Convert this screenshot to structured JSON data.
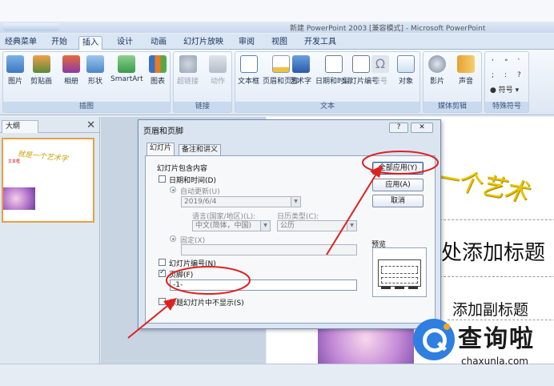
{
  "window": {
    "title": "新建 PowerPoint 2003 [兼容模式] - Microsoft PowerPoint"
  },
  "tabs": [
    "经典菜单",
    "开始",
    "插入",
    "设计",
    "动画",
    "幻灯片放映",
    "审阅",
    "视图",
    "开发工具"
  ],
  "active_tab": "插入",
  "ribbon": {
    "groups": {
      "illustrations": {
        "label": "插图",
        "buttons": [
          "图片",
          "剪贴画",
          "相册",
          "形状",
          "SmartArt",
          "图表"
        ]
      },
      "links": {
        "label": "链接",
        "buttons": [
          "超链接",
          "动作"
        ]
      },
      "text": {
        "label": "文本",
        "buttons": [
          "文本框",
          "页眉和页脚",
          "艺术字",
          "日期和时间",
          "幻灯片编号",
          "符号",
          "对象"
        ]
      },
      "media": {
        "label": "媒体剪辑",
        "buttons": [
          "影片",
          "声音"
        ]
      },
      "special": {
        "label": "特殊符号",
        "symbols": [
          "'",
          "°",
          "`",
          ";",
          ":",
          "?"
        ],
        "button": "符号"
      }
    }
  },
  "outline_pane": {
    "tab_label": "大纲",
    "close_glyph": "✕",
    "thumb_title": "就是一个艺术字",
    "thumb_subtitle": "文本框"
  },
  "slide": {
    "wordart": "一个艺术",
    "title_placeholder": "处添加标题",
    "subtitle_placeholder": "添加副标题"
  },
  "dialog": {
    "title": "页眉和页脚",
    "help": "?",
    "close": "✕",
    "tabs": [
      "幻灯片",
      "备注和讲义"
    ],
    "group_label": "幻灯片包含内容",
    "date_time": {
      "label": "日期和时间(D)",
      "checked": false
    },
    "auto_update": {
      "label": "自动更新(U)",
      "selected": true,
      "value": "2019/6/4"
    },
    "language": {
      "label": "语言(国家/地区)(L):",
      "value": "中文(简体，中国)"
    },
    "calendar": {
      "label": "日历类型(C):",
      "value": "公历"
    },
    "fixed": {
      "label": "固定(X)",
      "selected": true,
      "value": ""
    },
    "slide_number": {
      "label": "幻灯片编号(N)",
      "checked": false
    },
    "footer": {
      "label": "页脚(F)",
      "checked": true,
      "value": "-1-"
    },
    "hide_title": {
      "label": "标题幻灯片中不显示(S)",
      "checked": false
    },
    "buttons": {
      "apply_all": "全部应用(Y)",
      "apply": "应用(A)",
      "cancel": "取消"
    },
    "preview_label": "预览"
  },
  "watermark": {
    "brand": "查询啦",
    "url": "chaxunla.com"
  },
  "colors": {
    "annotation": "#e02020",
    "accent": "#2f7fe0",
    "wordart": "#e8c400"
  }
}
